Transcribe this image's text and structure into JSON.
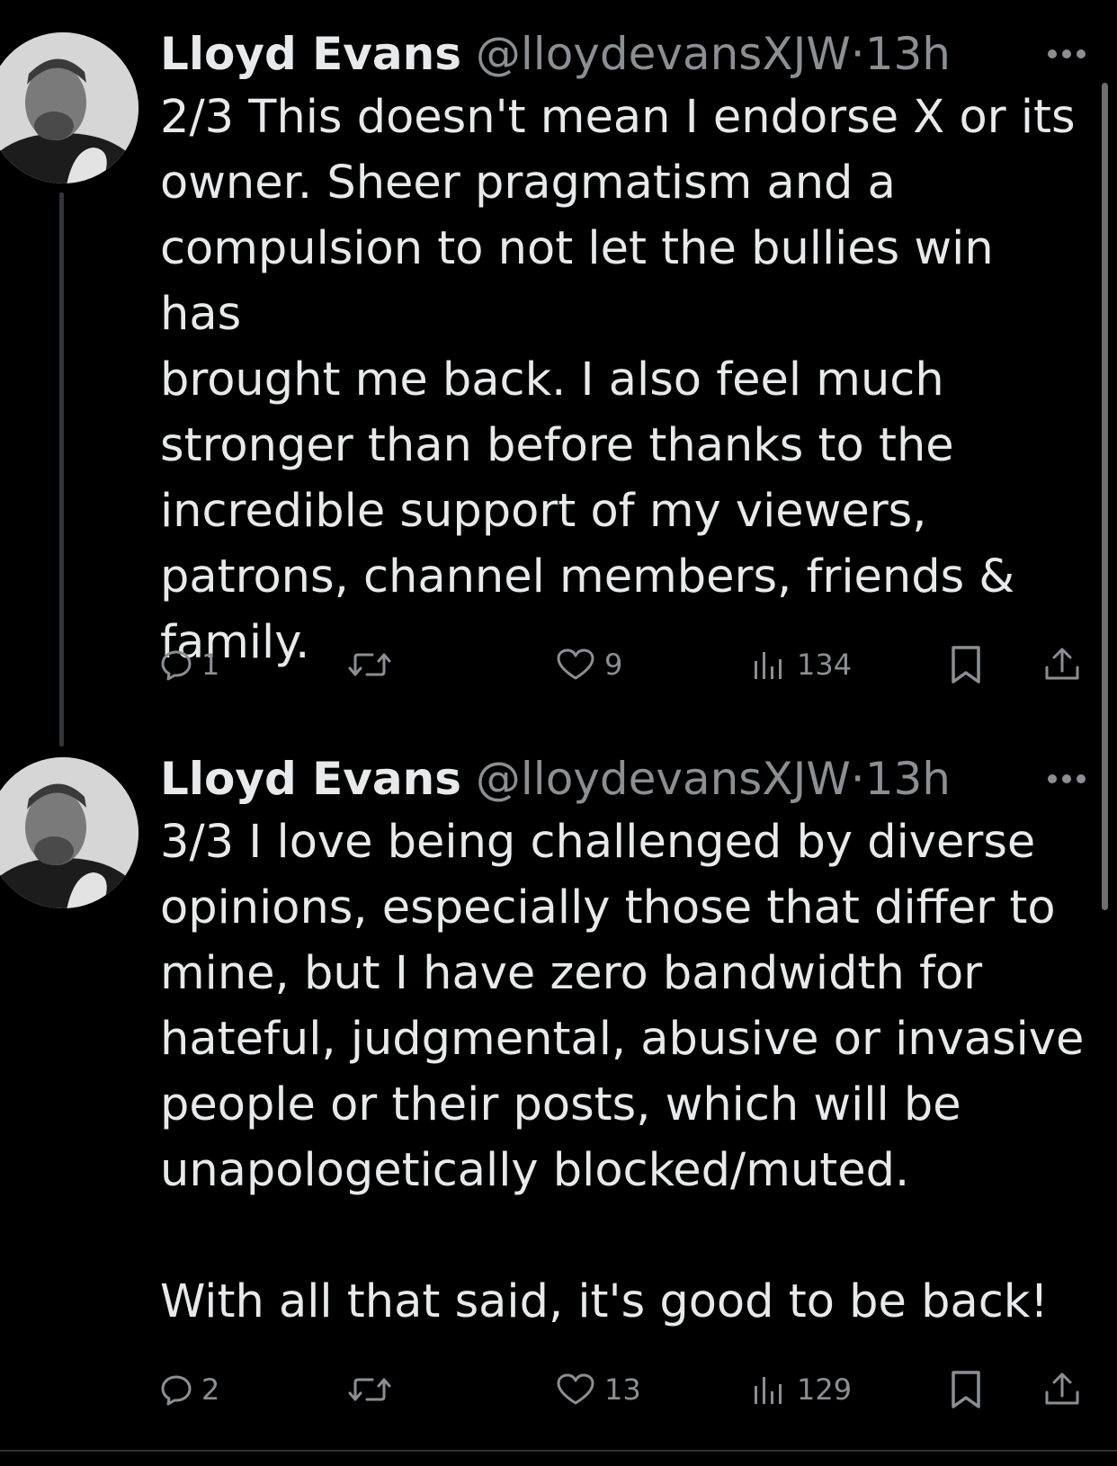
{
  "tweets": [
    {
      "author_name": "Lloyd Evans",
      "handle": "@lloydevansXJW",
      "separator": "·",
      "time": "13h",
      "text": "2/3 This doesn't mean I endorse X or its\nowner. Sheer pragmatism and a\ncompulsion to not let the bullies win has\nbrought me back. I also feel much\nstronger than before thanks to the\nincredible support of my viewers,\npatrons, channel members, friends &\nfamily.",
      "replies": "1",
      "likes": "9",
      "views": "134"
    },
    {
      "author_name": "Lloyd Evans",
      "handle": "@lloydevansXJW",
      "separator": "·",
      "time": "13h",
      "text": "3/3 I love being challenged by diverse\nopinions, especially those that differ to\nmine, but I have zero bandwidth for\nhateful, judgmental, abusive or invasive\npeople or their posts, which will be\nunapologetically blocked/muted.\n\nWith all that said, it's good to be back!",
      "replies": "2",
      "likes": "13",
      "views": "129"
    }
  ],
  "icons": {
    "more": "more-horizontal-icon",
    "reply": "reply-bubble-icon",
    "repost": "repost-arrows-icon",
    "like": "heart-outline-icon",
    "views": "bar-chart-views-icon",
    "bookmark": "bookmark-outline-icon",
    "share": "share-upload-icon"
  },
  "colors": {
    "background": "#000000",
    "text_primary": "#e7e9ea",
    "text_secondary": "#8b8f93"
  }
}
